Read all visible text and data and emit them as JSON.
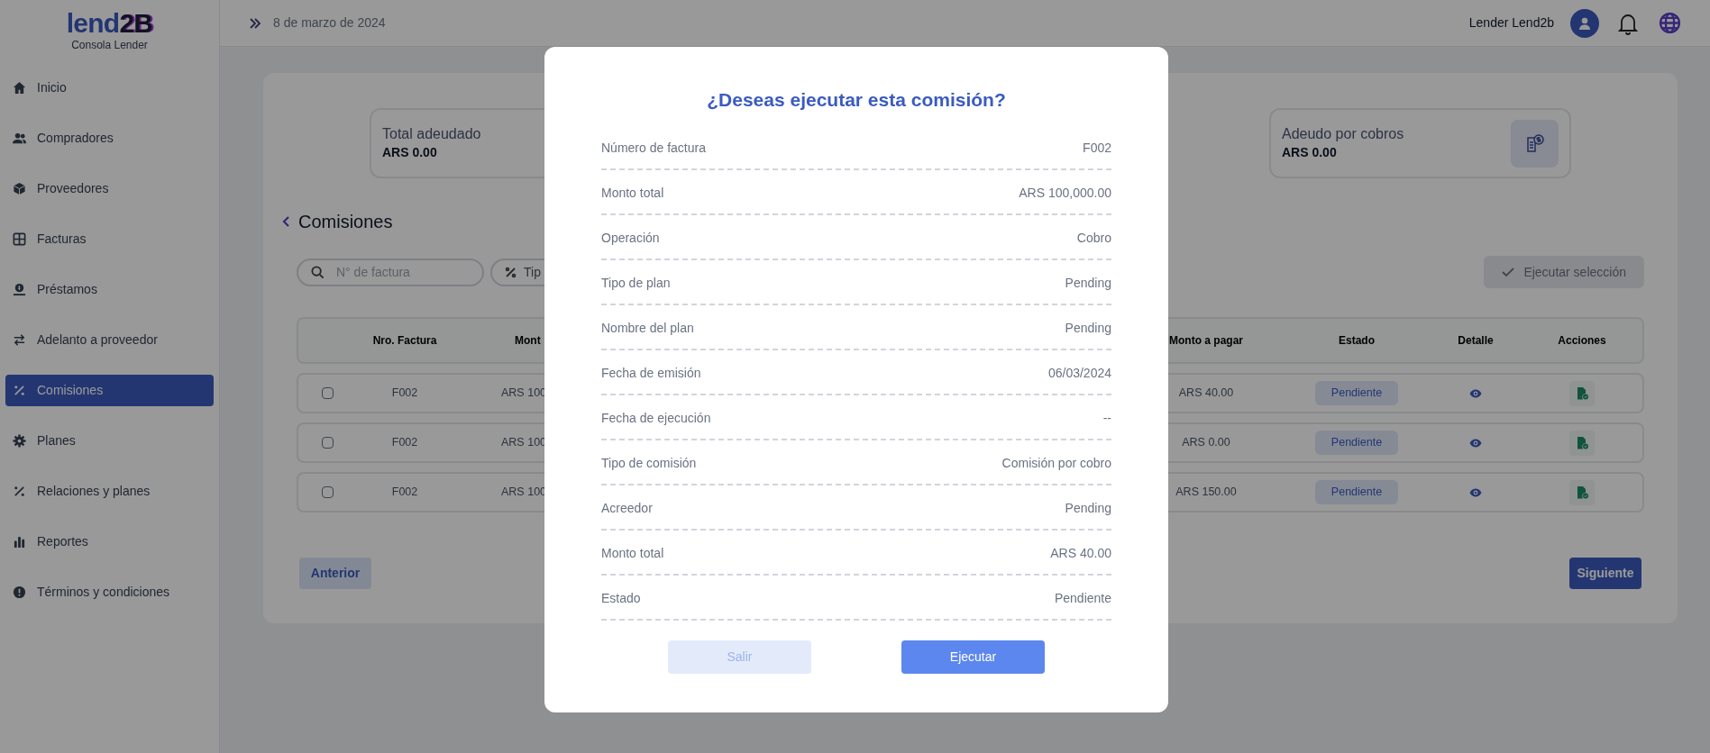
{
  "sidebar": {
    "logo_parts": [
      "lend",
      "2B"
    ],
    "subtitle": "Consola Lender",
    "items": [
      {
        "label": "Inicio",
        "selected": false
      },
      {
        "label": "Compradores",
        "selected": false
      },
      {
        "label": "Proveedores",
        "selected": false
      },
      {
        "label": "Facturas",
        "selected": false
      },
      {
        "label": "Préstamos",
        "selected": false
      },
      {
        "label": "Adelanto a proveedor",
        "selected": false
      },
      {
        "label": "Comisiones",
        "selected": true
      },
      {
        "label": "Planes",
        "selected": false
      },
      {
        "label": "Relaciones y planes",
        "selected": false
      },
      {
        "label": "Reportes",
        "selected": false
      },
      {
        "label": "Términos y condiciones",
        "selected": false
      }
    ]
  },
  "topbar": {
    "date": "8 de marzo de 2024",
    "user": "Lender Lend2b"
  },
  "stats": [
    {
      "title": "Total adeudado",
      "value": "ARS 0.00"
    },
    {
      "title": "Adeudo por cobros",
      "value": "ARS 0.00",
      "badge_icon": true
    }
  ],
  "section_title": "Comisiones",
  "filters": {
    "search_placeholder": "N° de factura",
    "type_filter": "Tip",
    "execute_button": {
      "label": "Ejecutar selección",
      "disabled": true
    }
  },
  "table": {
    "columns_left": [
      "Nro. Factura",
      "Mont"
    ],
    "columns_right": [
      "Monto a pagar",
      "Estado",
      "Detalle",
      "Acciones"
    ],
    "rows": [
      {
        "checked": false,
        "invoice": "F002",
        "amount": "ARS 100",
        "to_pay": "ARS 40.00",
        "status": "Pendiente"
      },
      {
        "checked": false,
        "invoice": "F002",
        "amount": "ARS 100",
        "to_pay": "ARS 0.00",
        "status": "Pendiente"
      },
      {
        "checked": false,
        "invoice": "F002",
        "amount": "ARS 100",
        "to_pay": "ARS 150.00",
        "status": "Pendiente"
      }
    ]
  },
  "pagination": {
    "previous": {
      "label": "Anterior",
      "disabled": true
    },
    "next": {
      "label": "Siguiente",
      "disabled": false
    }
  },
  "modal": {
    "title": "¿Deseas ejecutar esta comisión?",
    "rows": [
      {
        "label": "Número de factura",
        "value": "F002"
      },
      {
        "label": "Monto total",
        "value": "ARS 100,000.00"
      },
      {
        "label": "Operación",
        "value": "Cobro"
      },
      {
        "label": "Tipo de plan",
        "value": "Pending"
      },
      {
        "label": "Nombre del plan",
        "value": "Pending"
      },
      {
        "label": "Fecha de emisión",
        "value": "06/03/2024"
      },
      {
        "label": "Fecha de ejecución",
        "value": "--"
      },
      {
        "label": "Tipo de comisión",
        "value": "Comisión por cobro"
      },
      {
        "label": "Acreedor",
        "value": "Pending"
      },
      {
        "label": "Monto total",
        "value": "ARS 40.00"
      },
      {
        "label": "Estado",
        "value": "Pendiente"
      }
    ],
    "buttons": [
      {
        "label": "Salir",
        "kind": "secondary"
      },
      {
        "label": "Ejecutar",
        "kind": "primary"
      }
    ]
  }
}
